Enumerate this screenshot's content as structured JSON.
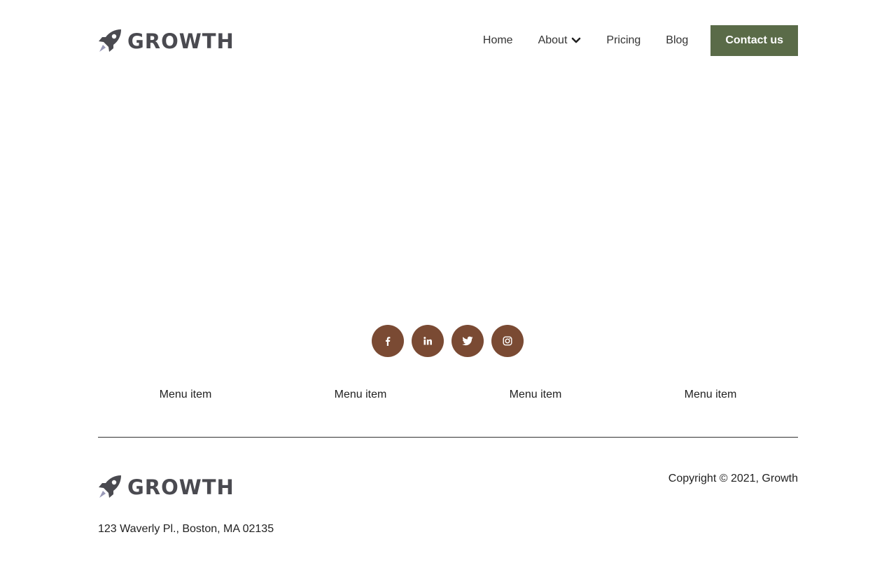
{
  "brand": {
    "name": "GROWTH",
    "logo_icon": "rocket-icon",
    "text_color": "#4a4a50",
    "icon_color": "#4a4a50",
    "flame_color": "#9a9ab8"
  },
  "nav": {
    "items": [
      {
        "label": "Home"
      },
      {
        "label": "About",
        "icon": "chevron-down-icon"
      },
      {
        "label": "Pricing"
      },
      {
        "label": "Blog"
      }
    ],
    "cta_label": "Contact us",
    "cta_color": "#5a6b48"
  },
  "social": {
    "color": "#7a4a33",
    "items": [
      {
        "icon": "facebook-icon"
      },
      {
        "icon": "linkedin-icon"
      },
      {
        "icon": "twitter-icon"
      },
      {
        "icon": "instagram-icon"
      }
    ]
  },
  "footer": {
    "menu": [
      {
        "label": "Menu item"
      },
      {
        "label": "Menu item"
      },
      {
        "label": "Menu item"
      },
      {
        "label": "Menu item"
      }
    ],
    "copyright": "Copyright © 2021, Growth",
    "address": "123 Waverly Pl., Boston, MA 02135"
  }
}
